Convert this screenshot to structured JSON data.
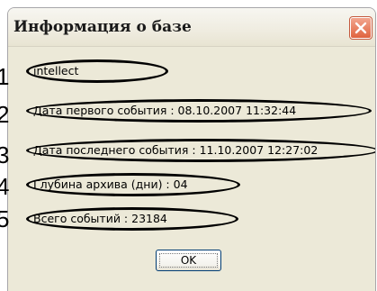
{
  "window": {
    "title": "Информация о базе",
    "close_icon": "close-icon"
  },
  "callouts": [
    "1",
    "2",
    "3",
    "4",
    "5"
  ],
  "fields": [
    "intellect",
    "Дата первого события : 08.10.2007 11:32:44",
    "Дата последнего события : 11.10.2007 12:27:02",
    "Глубина архива (дни) : 04",
    "Всего событий : 23184"
  ],
  "buttons": {
    "ok_label": "OK"
  },
  "colors": {
    "dialog_bg": "#ece9d8",
    "close_button": "#e0633f",
    "ok_border": "#003c74"
  }
}
